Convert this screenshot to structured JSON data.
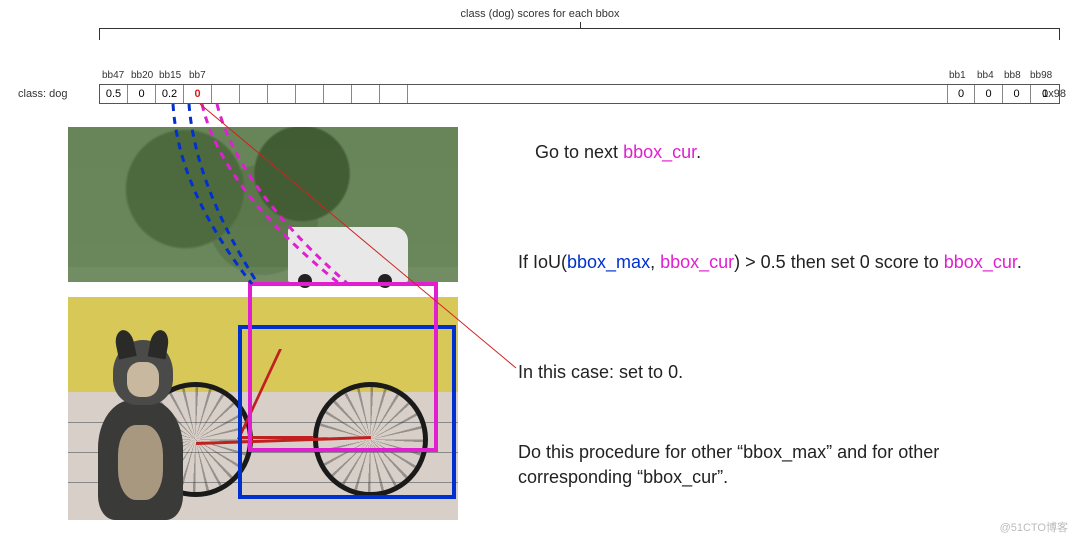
{
  "diagram_title": "class (dog) scores for each bbox",
  "class_label": "class: dog",
  "shape_label": "1x98",
  "left_group": [
    {
      "name": "bb47",
      "value": "0.5"
    },
    {
      "name": "bb20",
      "value": "0"
    },
    {
      "name": "bb15",
      "value": "0.2"
    },
    {
      "name": "bb7",
      "value": "0",
      "highlight": true
    }
  ],
  "right_group": [
    {
      "name": "bb1",
      "value": "0"
    },
    {
      "name": "bb4",
      "value": "0"
    },
    {
      "name": "bb8",
      "value": "0"
    },
    {
      "name": "bb98",
      "value": "0"
    }
  ],
  "text_line1_a": "Go to next ",
  "text_line1_b": "bbox_cur",
  "text_line1_c": ".",
  "text_line2_a": "If IoU(",
  "text_line2_b": "bbox_max",
  "text_line2_c": ", ",
  "text_line2_d": "bbox_cur",
  "text_line2_e": ") > 0.5 then set 0 score to ",
  "text_line2_f": "bbox_cur",
  "text_line2_g": ".",
  "text_line3": "In this case: set to 0.",
  "text_line4": "Do this procedure for other “bbox_max” and for other corresponding “bbox_cur”.",
  "watermark": "@51CTO博客"
}
